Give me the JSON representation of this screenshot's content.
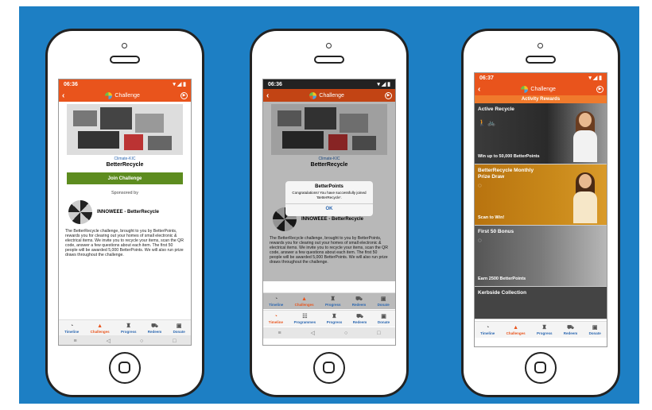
{
  "phones": [
    {
      "status_time": "06:36",
      "status_right": "▾ ◢ ▮",
      "header_title": "Challenge",
      "org_name": "Climate-KIC",
      "challenge_name": "BetterRecycle",
      "join_label": "Join Challenge",
      "sponsored_by": "Sponsored by",
      "sponsor_name": "INNOWEEE - BetterRecycle",
      "description": "The BetterRecycle challenge, brought to you by BetterPoints, rewards you for clearing out your homes of small electronic & electrical items. We invite you to recycle your items, scan the QR code, answer a few questions about each item. The first 50 people will be awarded 5,000 BetterPoints. We will also run prize draws throughout the challenge.",
      "tabs": [
        "Timeline",
        "Challenges",
        "Progress",
        "Redeem",
        "Donate"
      ]
    },
    {
      "status_time": "06:36",
      "status_right": "▾ ◢ ▮",
      "header_title": "Challenge",
      "org_name": "Climate-KIC",
      "challenge_name": "BetterRecycle",
      "dialog_title": "BetterPoints",
      "dialog_message": "Congratulations! You have successfully joined 'BetterRecycle'.",
      "dialog_ok": "OK",
      "sponsor_name": "INNOWEEE - BetterRecycle",
      "description": "The BetterRecycle challenge, brought to you by BetterPoints, rewards you for clearing out your homes of small electronic & electrical items. We invite you to recycle your items, scan the QR code, answer a few questions about each item. The first 50 people will be awarded 5,000 BetterPoints. We will also run prize draws throughout the challenge.",
      "tabs": [
        "Timeline",
        "Challenges",
        "Progress",
        "Redeem",
        "Donate"
      ],
      "tabs_lower": [
        "Timeline",
        "Programmes",
        "Progress",
        "Redeem",
        "Donate"
      ]
    },
    {
      "status_time": "06:37",
      "status_right": "▾ ◢ ▮",
      "header_title": "Challenge",
      "subheader": "Activity Rewards",
      "cards": [
        {
          "title": "Active Recycle",
          "footer": "Win up to 50,000 BetterPoints"
        },
        {
          "title": "BetterRecycle Monthly Prize Draw",
          "footer": "Scan to Win!"
        },
        {
          "title": "First 50 Bonus",
          "footer": "Earn 2500 BetterPoints"
        }
      ],
      "partial_card_title": "Kerbside Collection",
      "tabs": [
        "Timeline",
        "Challenges",
        "Progress",
        "Redeem",
        "Donate"
      ]
    }
  ],
  "colors": {
    "background": "#1d7fc4",
    "accent": "#e9541c",
    "join": "#5d8c1f",
    "link": "#2a66b0"
  }
}
